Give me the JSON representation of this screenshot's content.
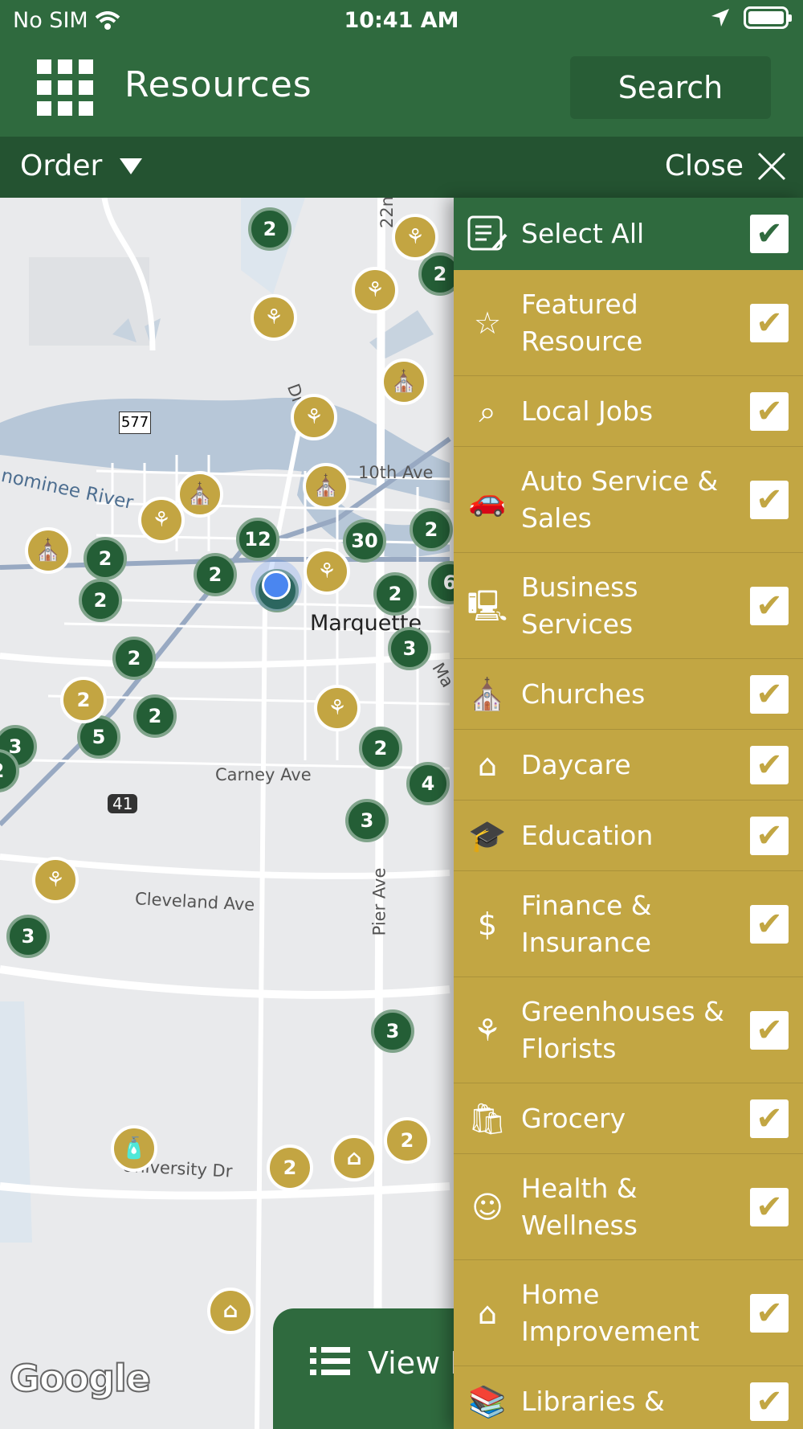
{
  "status_bar": {
    "carrier": "No SIM",
    "time": "10:41 AM"
  },
  "header": {
    "title": "Resources",
    "search_label": "Search"
  },
  "filter_bar": {
    "order_label": "Order",
    "close_label": "Close"
  },
  "map": {
    "labels": {
      "route": "577",
      "street_22": "22n",
      "river": "nominee River",
      "tenth": "10th Ave",
      "city": "Marquette",
      "carney": "Carney Ave",
      "highway": "41",
      "cleveland": "Cleveland Ave",
      "pier": "Pier Ave",
      "university": "University Dr",
      "market": "Ma",
      "third_dr": "Dr"
    },
    "clusters": [
      {
        "count": "2"
      },
      {
        "count": "2"
      },
      {
        "count": "12"
      },
      {
        "count": "30"
      },
      {
        "count": "2"
      },
      {
        "count": "2"
      },
      {
        "count": "2"
      },
      {
        "count": "2"
      },
      {
        "count": "2"
      },
      {
        "count": "2"
      },
      {
        "count": "3"
      },
      {
        "count": "2"
      },
      {
        "count": "2"
      },
      {
        "count": "5"
      },
      {
        "count": "3"
      },
      {
        "count": "2"
      },
      {
        "count": "4"
      },
      {
        "count": "3"
      },
      {
        "count": "3"
      },
      {
        "count": "3"
      },
      {
        "count": "2"
      },
      {
        "count": "6"
      }
    ],
    "gold_clusters": [
      {
        "count": "2"
      },
      {
        "count": "2"
      },
      {
        "count": "2"
      }
    ],
    "attribution": "Google",
    "view_list_label": "View L"
  },
  "colors": {
    "primary_green": "#2f6a3e",
    "dark_green": "#245331",
    "gold": "#c2a643"
  },
  "drawer": {
    "select_all": {
      "label": "Select All",
      "checked": true,
      "icon": "list-edit-icon"
    },
    "categories": [
      {
        "label": "Featured Resource",
        "icon": "star-icon",
        "checked": true
      },
      {
        "label": "Local Jobs",
        "icon": "job-search-icon",
        "checked": true
      },
      {
        "label": "Auto Service & Sales",
        "icon": "car-icon",
        "checked": true
      },
      {
        "label": "Business Services",
        "icon": "computer-hand-icon",
        "checked": true
      },
      {
        "label": "Churches",
        "icon": "church-icon",
        "checked": true
      },
      {
        "label": "Daycare",
        "icon": "daycare-icon",
        "checked": true
      },
      {
        "label": "Education",
        "icon": "graduation-cap-icon",
        "checked": true
      },
      {
        "label": "Finance & Insurance",
        "icon": "money-bag-icon",
        "checked": true
      },
      {
        "label": "Greenhouses & Florists",
        "icon": "gardener-icon",
        "checked": true
      },
      {
        "label": "Grocery",
        "icon": "grocery-bag-icon",
        "checked": true
      },
      {
        "label": "Health & Wellness",
        "icon": "wellness-icon",
        "checked": true
      },
      {
        "label": "Home Improvement",
        "icon": "home-tools-icon",
        "checked": true
      },
      {
        "label": "Libraries &",
        "icon": "books-icon",
        "checked": true
      }
    ]
  }
}
